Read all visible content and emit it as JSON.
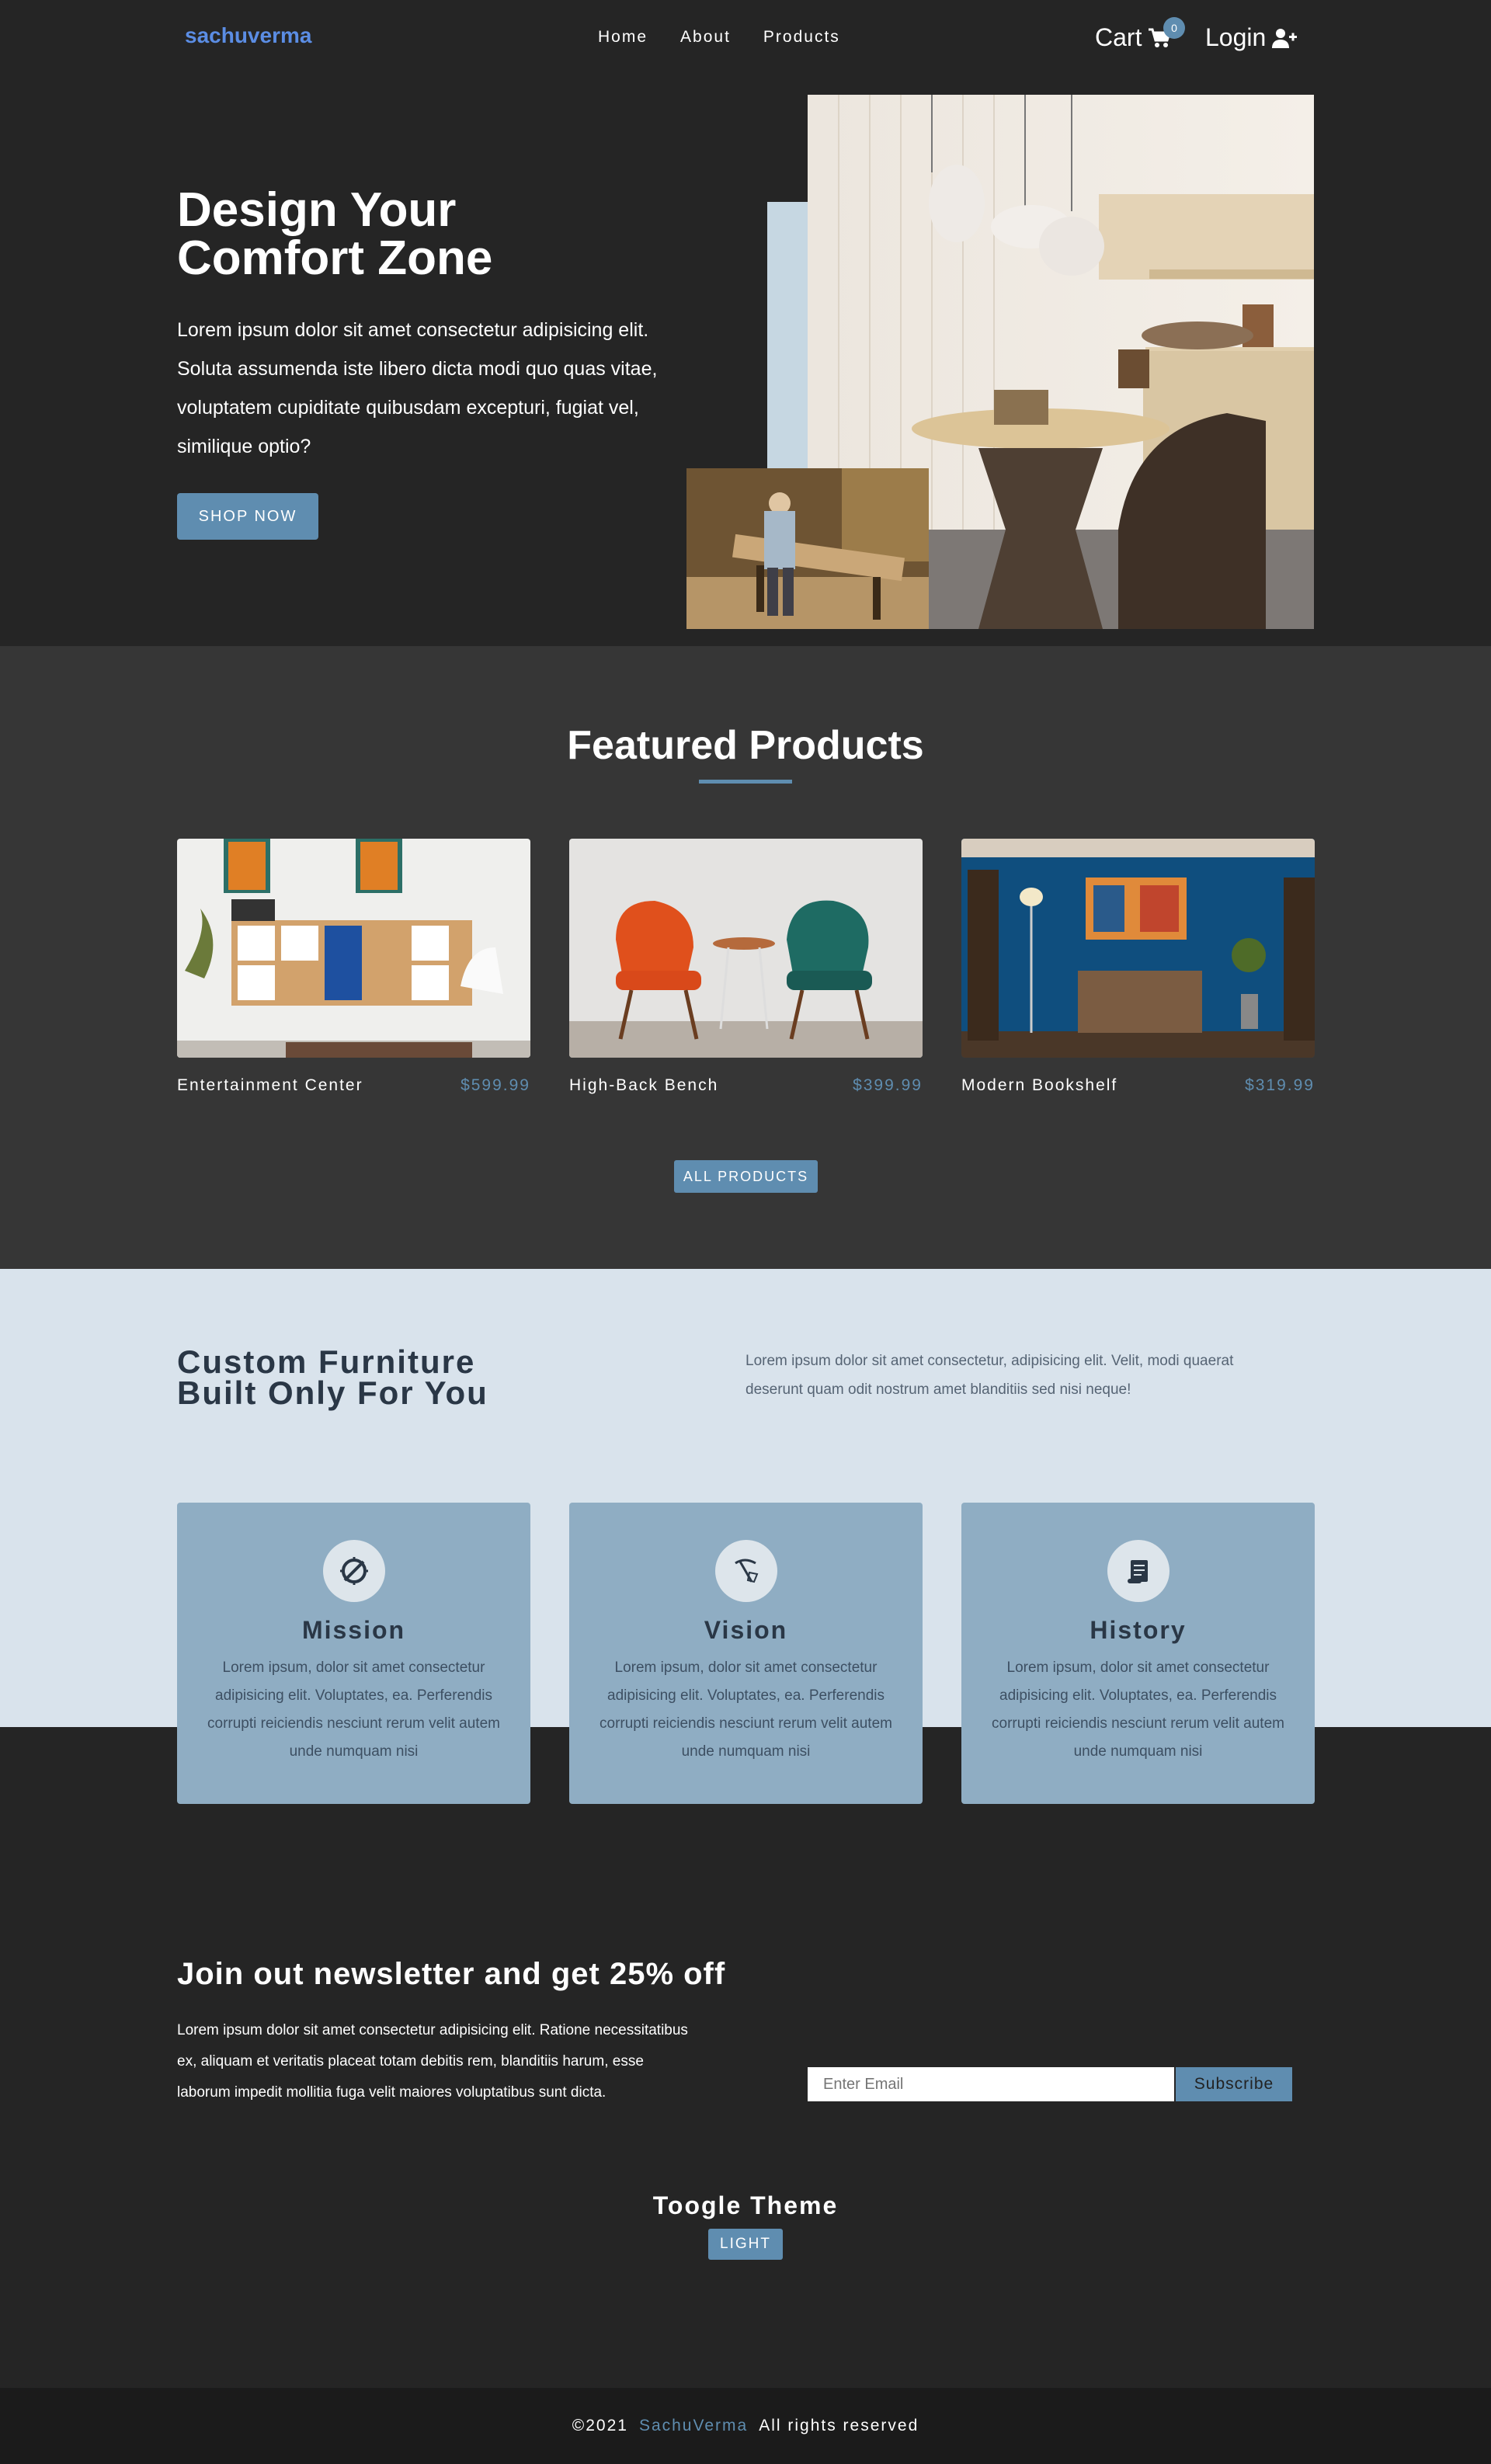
{
  "nav": {
    "logo": "sachuverma",
    "links": [
      "Home",
      "About",
      "Products"
    ],
    "cart_label": "Cart",
    "cart_count": "0",
    "login_label": "Login"
  },
  "hero": {
    "title": "Design Your Comfort Zone",
    "text": "Lorem ipsum dolor sit amet consectetur adipisicing elit. Soluta assumenda iste libero dicta modi quo quas vitae, voluptatem cupiditate quibusdam excepturi, fugiat vel, similique optio?",
    "button": "SHOP NOW"
  },
  "featured": {
    "title": "Featured Products",
    "products": [
      {
        "name": "Entertainment Center",
        "price": "$599.99"
      },
      {
        "name": "High-Back Bench",
        "price": "$399.99"
      },
      {
        "name": "Modern Bookshelf",
        "price": "$319.99"
      }
    ],
    "button": "ALL PRODUCTS"
  },
  "about": {
    "title": "Custom Furniture Built Only For You",
    "text": "Lorem ipsum dolor sit amet consectetur, adipisicing elit. Velit, modi quaerat deserunt quam odit nostrum amet blanditiis sed nisi neque!",
    "cards": [
      {
        "title": "Mission",
        "text": "Lorem ipsum, dolor sit amet consectetur adipisicing elit. Voluptates, ea. Perferendis corrupti reiciendis nesciunt rerum velit autem unde numquam nisi",
        "icon": "compass-icon"
      },
      {
        "title": "Vision",
        "text": "Lorem ipsum, dolor sit amet consectetur adipisicing elit. Voluptates, ea. Perferendis corrupti reiciendis nesciunt rerum velit autem unde numquam nisi",
        "icon": "pick-icon"
      },
      {
        "title": "History",
        "text": "Lorem ipsum, dolor sit amet consectetur adipisicing elit. Voluptates, ea. Perferendis corrupti reiciendis nesciunt rerum velit autem unde numquam nisi",
        "icon": "scroll-icon"
      }
    ]
  },
  "newsletter": {
    "title": "Join out newsletter and get 25% off",
    "text": "Lorem ipsum dolor sit amet consectetur adipisicing elit. Ratione necessitatibus ex, aliquam et veritatis placeat totam debitis rem, blanditiis harum, esse laborum impedit mollitia fuga velit maiores voluptatibus sunt dicta.",
    "email_placeholder": "Enter Email",
    "button": "Subscribe"
  },
  "theme": {
    "title": "Toogle Theme",
    "button": "LIGHT"
  },
  "footer": {
    "copyright": "©2021",
    "brand": "SachuVerma",
    "rights": "All rights reserved"
  },
  "colors": {
    "accent": "#5f8db0",
    "logo": "#5b8de4",
    "dark_bg": "#252525",
    "section_bg": "#363636",
    "light_bg": "#d9e3ec",
    "card_bg": "#8fadc3"
  }
}
